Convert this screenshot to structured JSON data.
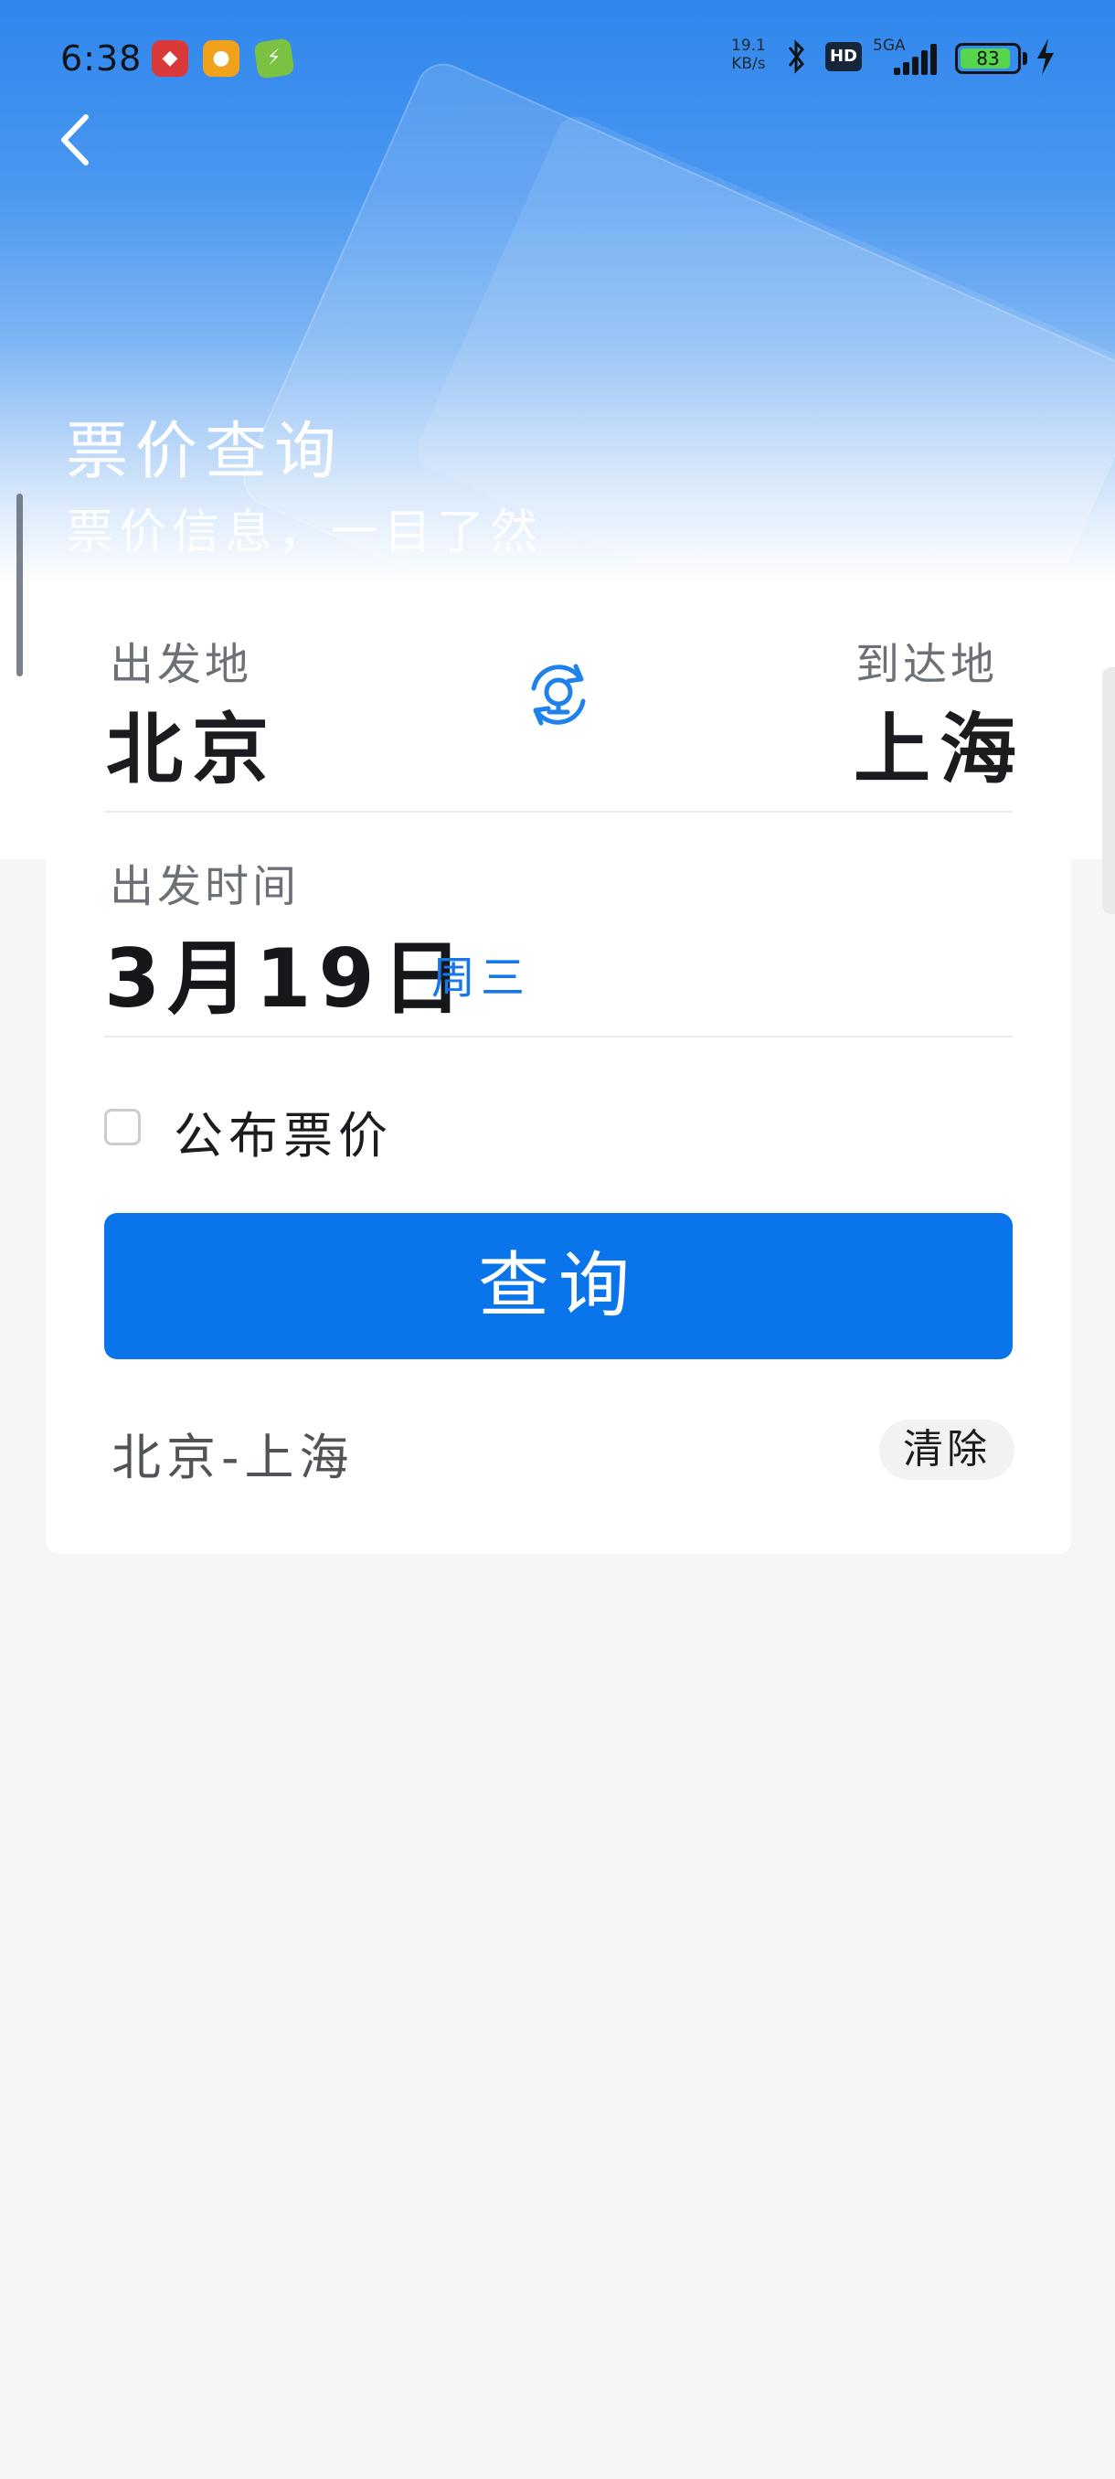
{
  "status_bar": {
    "time": "6:38",
    "net_speed_value": "19.1",
    "net_speed_unit": "KB/s",
    "hd_badge": "HD",
    "network_type": "5GA",
    "battery_level": "83",
    "icons": [
      "app-notification-icon",
      "app-notification-icon",
      "app-notification-icon",
      "bluetooth-icon",
      "signal-icon",
      "battery-icon",
      "charging-icon"
    ]
  },
  "header": {
    "title": "票价查询",
    "subtitle": "票价信息，一目了然"
  },
  "form": {
    "from_label": "出发地",
    "from_city": "北京",
    "to_label": "到达地",
    "to_city": "上海",
    "date_label": "出发时间",
    "date_value": "3月19日",
    "weekday": "周三",
    "checkbox_label": "公布票价",
    "checkbox_checked": false,
    "query_button": "查询"
  },
  "history": {
    "item": "北京-上海",
    "clear_button": "清除"
  },
  "colors": {
    "primary": "#0a74ea",
    "weekday": "#1677e8",
    "header_top": "#2f86ec"
  }
}
